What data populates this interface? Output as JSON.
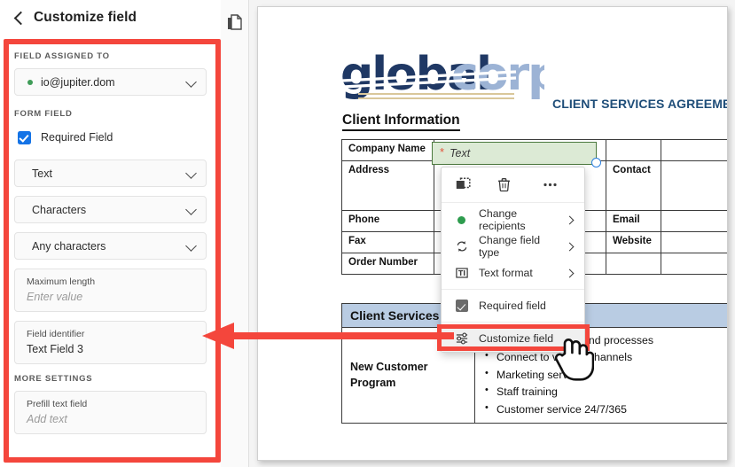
{
  "sidebar": {
    "back_icon": "chevron-left-icon",
    "title": "Customize field",
    "assigned_label": "FIELD ASSIGNED TO",
    "assigned_value": "io@jupiter.dom",
    "assigned_status_color": "#3f9c58",
    "form_field_label": "FORM FIELD",
    "required_checkbox_label": "Required Field",
    "required_checked": true,
    "checkbox_color": "#1473e6",
    "field_type": "Text",
    "count_unit": "Characters",
    "char_rule": "Any characters",
    "max_length_label": "Maximum length",
    "max_length_placeholder": "Enter value",
    "identifier_label": "Field identifier",
    "identifier_value": "Text Field 3",
    "more_settings_label": "MORE SETTINGS",
    "prefill_label": "Prefill text field",
    "prefill_placeholder": "Add text",
    "highlight_color": "#f4463c"
  },
  "toolstrip": {
    "pages_icon": "pages-duplicate-icon"
  },
  "document": {
    "logo_primary": "global",
    "logo_secondary": "corp",
    "logo_primary_color": "#1f3864",
    "logo_secondary_color": "#9cb3d5",
    "title": "CLIENT SERVICES AGREEMENT",
    "title_color": "#1f4e79",
    "section_heading": "Client Information",
    "client_rows": [
      {
        "label": "Company Name",
        "value": "",
        "label2": "",
        "value2": ""
      },
      {
        "label": "Address",
        "value": "",
        "label2": "Contact",
        "value2": ""
      },
      {
        "label": "Phone",
        "value": "",
        "label2": "Email",
        "value2": ""
      },
      {
        "label": "Fax",
        "value": "",
        "label2": "Website",
        "value2": ""
      },
      {
        "label": "Order Number",
        "value": "",
        "label2": "",
        "value2": ""
      }
    ],
    "active_field": {
      "required_marker": "*",
      "placeholder": "Text",
      "fill_color": "#dcead5",
      "border_color": "#4c7a3f",
      "handle_icon": "resize-handle-icon"
    },
    "services_heading": "Client Services",
    "services_header_bg": "#b9cce3",
    "services_row_label": "New Customer Program",
    "services_bullets": [
      "Set up properties and processes",
      "Connect to vendor channels",
      "Marketing services",
      "Staff training",
      "Customer service 24/7/365"
    ]
  },
  "context_menu": {
    "toolbar_icons": [
      {
        "name": "duplicate-icon"
      },
      {
        "name": "delete-icon"
      },
      {
        "name": "more-options-icon"
      }
    ],
    "items": [
      {
        "label": "Change recipients",
        "icon": "recipient-dot-icon",
        "submenu": true
      },
      {
        "label": "Change field type",
        "icon": "refresh-icon",
        "submenu": true
      },
      {
        "label": "Text format",
        "icon": "text-format-icon",
        "submenu": true
      },
      {
        "label": "Required field",
        "icon": "checkbox-checked-icon",
        "submenu": false
      },
      {
        "label": "Customize field",
        "icon": "sliders-icon",
        "submenu": false
      }
    ],
    "highlighted_item": "Customize field"
  },
  "annotations": {
    "arrow_color": "#f4463c",
    "cursor_icon": "pointing-hand-cursor"
  }
}
